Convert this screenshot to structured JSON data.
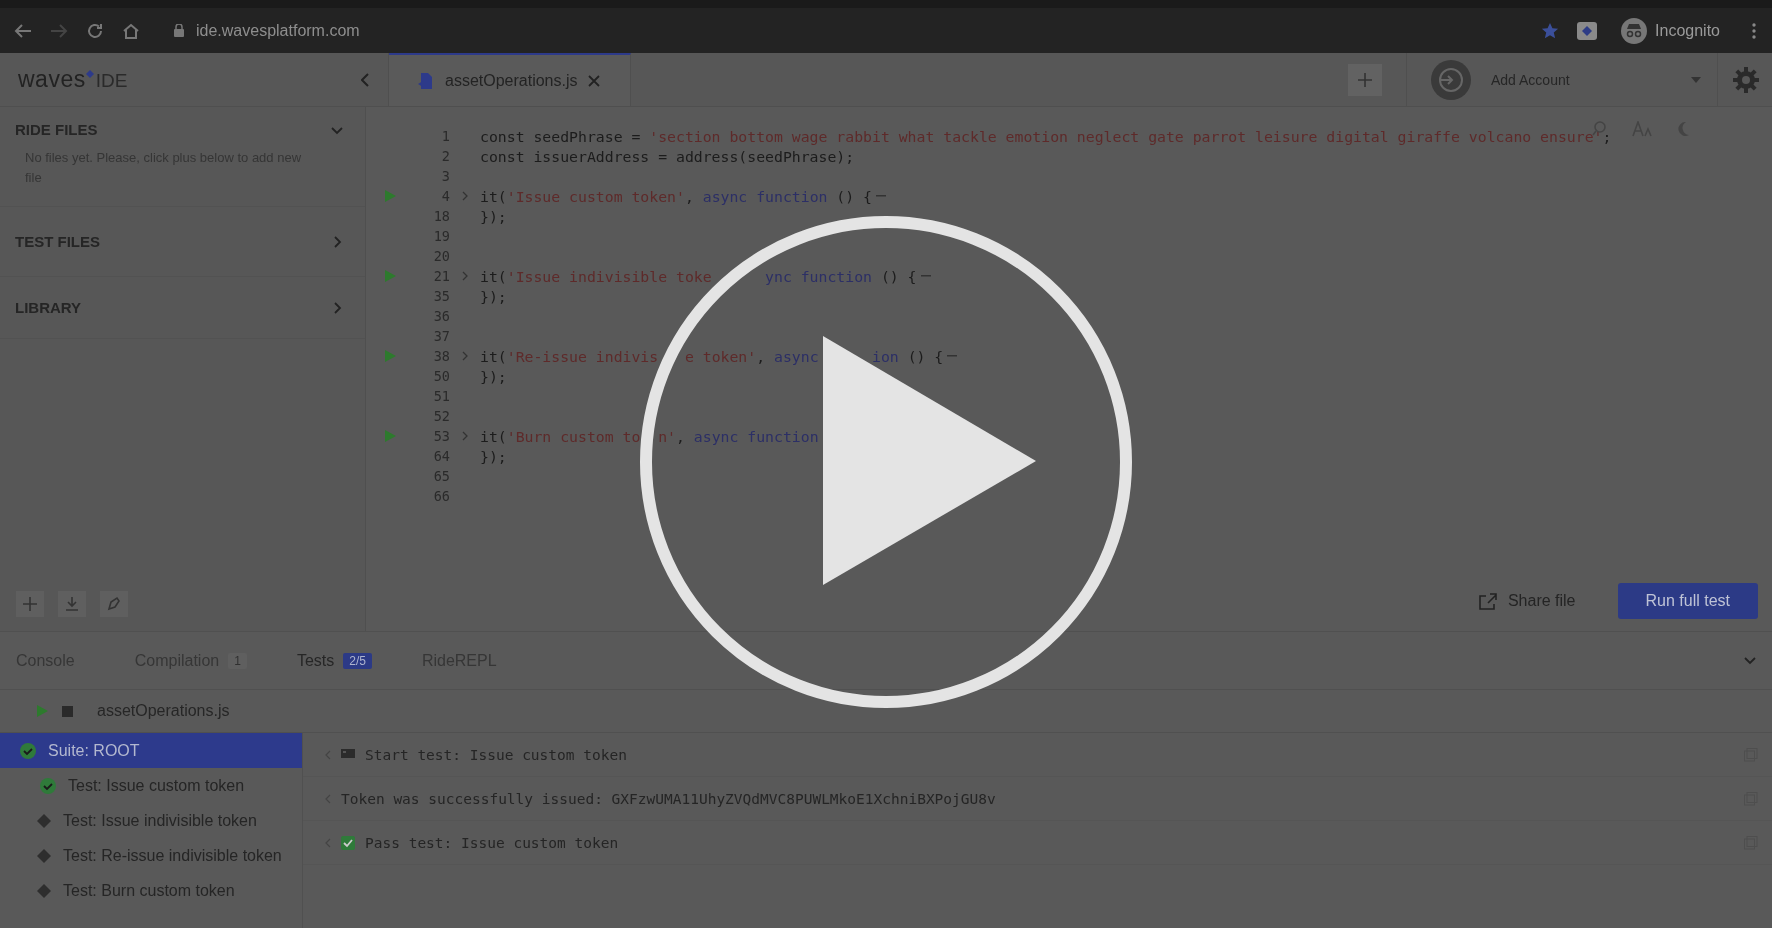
{
  "browser": {
    "address": "ide.wavesplatform.com",
    "profile": "Incognito"
  },
  "header": {
    "logo": {
      "brand": "waves",
      "suffix": "IDE"
    },
    "file_tab": {
      "label": "assetOperations.js",
      "selected": true
    },
    "account": {
      "label": "Add Account"
    }
  },
  "sidebar": {
    "sections": [
      {
        "title": "RIDE FILES",
        "expanded": true,
        "message": "No files yet. Please, click plus below to add new file"
      },
      {
        "title": "TEST FILES",
        "expanded": false
      },
      {
        "title": "LIBRARY",
        "expanded": false
      }
    ]
  },
  "code_lines": [
    {
      "number": "1",
      "runnable": false,
      "folded": false,
      "parts": [
        {
          "kind": "plain",
          "text": "const seedPhrase = "
        },
        {
          "kind": "string",
          "text": "'section bottom wage rabbit what tackle emotion neglect gate parrot leisure digital giraffe volcano ensure'"
        },
        {
          "kind": "plain",
          "text": ";"
        }
      ]
    },
    {
      "number": "2",
      "runnable": false,
      "folded": false,
      "parts": [
        {
          "kind": "plain",
          "text": "const issuerAddress = address(seedPhrase);"
        }
      ]
    },
    {
      "number": "3",
      "runnable": false,
      "folded": false
    },
    {
      "number": "4",
      "runnable": true,
      "folded": true,
      "parts": [
        {
          "kind": "plain",
          "text": "it("
        },
        {
          "kind": "string",
          "text": "'Issue custom token'"
        },
        {
          "kind": "plain",
          "text": ", "
        },
        {
          "kind": "keyword",
          "text": "async function"
        },
        {
          "kind": "plain",
          "text": " () {"
        }
      ]
    },
    {
      "number": "18",
      "runnable": false,
      "folded": false,
      "parts": [
        {
          "kind": "plain",
          "text": "});"
        }
      ]
    },
    {
      "number": "19",
      "runnable": false,
      "folded": false
    },
    {
      "number": "20",
      "runnable": false,
      "folded": false
    },
    {
      "number": "21",
      "runnable": true,
      "folded": true,
      "parts": [
        {
          "kind": "plain",
          "text": "it("
        },
        {
          "kind": "string",
          "text": "'Issue indivisible toke"
        },
        {
          "kind": "covered"
        },
        {
          "kind": "covered"
        },
        {
          "kind": "covered"
        },
        {
          "kind": "covered"
        },
        {
          "kind": "covered"
        },
        {
          "kind": "covered"
        },
        {
          "kind": "keyword",
          "text": "ync function"
        },
        {
          "kind": "plain",
          "text": " () {"
        }
      ]
    },
    {
      "number": "35",
      "runnable": false,
      "folded": false,
      "parts": [
        {
          "kind": "plain",
          "text": "});"
        }
      ]
    },
    {
      "number": "36",
      "runnable": false,
      "folded": false
    },
    {
      "number": "37",
      "runnable": false,
      "folded": false
    },
    {
      "number": "38",
      "runnable": true,
      "folded": true,
      "parts": [
        {
          "kind": "plain",
          "text": "it("
        },
        {
          "kind": "string",
          "text": "'Re-issue indivis"
        },
        {
          "kind": "covered"
        },
        {
          "kind": "covered"
        },
        {
          "kind": "covered"
        },
        {
          "kind": "string",
          "text": "e token'"
        },
        {
          "kind": "plain",
          "text": ", "
        },
        {
          "kind": "keyword",
          "text": "async"
        },
        {
          "kind": "covered"
        },
        {
          "kind": "covered"
        },
        {
          "kind": "covered"
        },
        {
          "kind": "covered"
        },
        {
          "kind": "covered"
        },
        {
          "kind": "covered"
        },
        {
          "kind": "keyword",
          "text": "ion"
        },
        {
          "kind": "plain",
          "text": " () {"
        }
      ]
    },
    {
      "number": "50",
      "runnable": false,
      "folded": false,
      "parts": [
        {
          "kind": "plain",
          "text": "});"
        }
      ]
    },
    {
      "number": "51",
      "runnable": false,
      "folded": false
    },
    {
      "number": "52",
      "runnable": false,
      "folded": false
    },
    {
      "number": "53",
      "runnable": true,
      "folded": true,
      "cut": true,
      "parts": [
        {
          "kind": "plain",
          "text": "it("
        },
        {
          "kind": "string",
          "text": "'Burn custom to"
        },
        {
          "kind": "covered"
        },
        {
          "kind": "covered"
        },
        {
          "kind": "string",
          "text": "n'"
        },
        {
          "kind": "plain",
          "text": ", "
        },
        {
          "kind": "keyword",
          "text": "async function"
        }
      ]
    },
    {
      "number": "64",
      "runnable": false,
      "folded": false,
      "parts": [
        {
          "kind": "plain",
          "text": "});"
        }
      ]
    },
    {
      "number": "65",
      "runnable": false,
      "folded": false
    },
    {
      "number": "66",
      "runnable": false,
      "folded": false
    }
  ],
  "toolbar": {
    "share": "Share file",
    "run": "Run full test"
  },
  "panel_tabs": [
    {
      "label": "Console",
      "selected": false
    },
    {
      "label": "Compilation",
      "badge": "1",
      "selected": false
    },
    {
      "label": "Tests",
      "badge": "2/5",
      "selected": true
    },
    {
      "label": "RideREPL",
      "selected": false
    }
  ],
  "test_tree": {
    "file": "assetOperations.js",
    "suite": {
      "label": "Suite: ROOT",
      "selected": true,
      "kind": "passed"
    },
    "tests": [
      {
        "label": "Test: Issue custom token",
        "kind": "passed",
        "selected": false
      },
      {
        "label": "Test: Issue indivisible token",
        "kind": "pending",
        "selected": false
      },
      {
        "label": "Test: Re-issue indivisible token",
        "kind": "pending",
        "selected": false
      },
      {
        "label": "Test: Burn custom token",
        "kind": "pending",
        "selected": false
      }
    ]
  },
  "log": [
    {
      "kind": "flag",
      "text": "Start test: Issue custom token"
    },
    {
      "kind": "plain",
      "text": "Token was successfully issued: GXFzwUMA11UhyZVQdMVC8PUWLMkoE1XchniBXPojGU8v"
    },
    {
      "kind": "check",
      "text": "Pass test: Issue custom token"
    }
  ]
}
